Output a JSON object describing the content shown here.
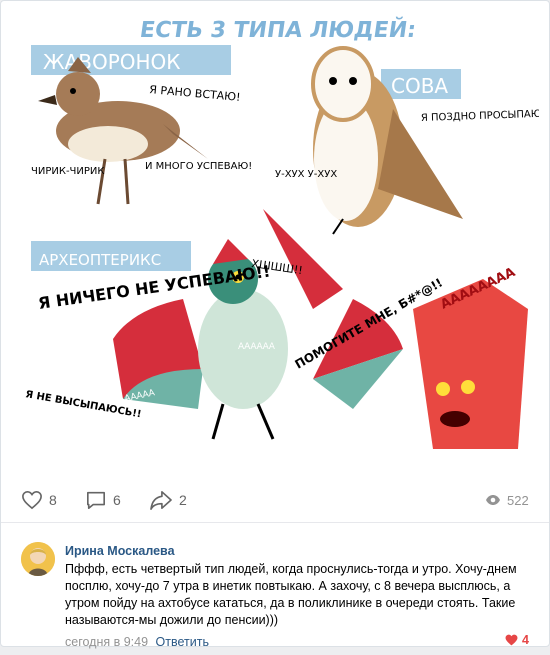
{
  "image": {
    "title": "ЕСТЬ 3 ТИПА ЛЮДЕЙ:",
    "lark": {
      "label": "ЖАВОРОНОК",
      "speech_main": "Я РАНО ВСТАЮ!",
      "speech_left": "ЧИРИК-ЧИРИК",
      "speech_right": "И МНОГО УСПЕВАЮ!"
    },
    "owl": {
      "label": "СОВА",
      "speech_main": "Я ПОЗДНО ПРОСЫПАЮСЬ, ЗАТО ОЧЕНЬ РАБОТОСПОСОБЕН ВЕЧЕРОМ.",
      "speech_left": "У-ХУХ У-ХУХ"
    },
    "archaeopteryx": {
      "label": "АРХЕОПТЕРИКС",
      "speech_main": "Я НИЧЕГО НЕ УСПЕВАЮ!!",
      "speech_sleep": "Я НЕ ВЫСЫПАЮСЬ!!",
      "speech_help": "ПОМОГИТЕ МНЕ, Б#*@!!",
      "scream_low": "ААААААА",
      "scream_mid": "АААААА",
      "scream_left": "ААААААА",
      "hiss": "ХШШШ!!",
      "scream_right": "АААААААА"
    }
  },
  "actions": {
    "likes": "8",
    "comments": "6",
    "shares": "2",
    "views": "522"
  },
  "comment": {
    "author": "Ирина Москалева",
    "text": "Пффф, есть четвертый тип людей, когда проснулись-тогда и утро. Хочу-днем посплю, хочу-до 7 утра в инетик повтыкаю. А захочу, с 8 вечера выcплюсь, а утром пойду на ахтобусе кататься, да в поликлинике в очереди стоять. Такие называются-мы дожили до пенсии)))",
    "time": "сегодня в 9:49",
    "reply": "Ответить",
    "likes": "4"
  },
  "colors": {
    "link": "#2a5885",
    "label_bg": "#a8cde4",
    "like": "#e64646"
  }
}
